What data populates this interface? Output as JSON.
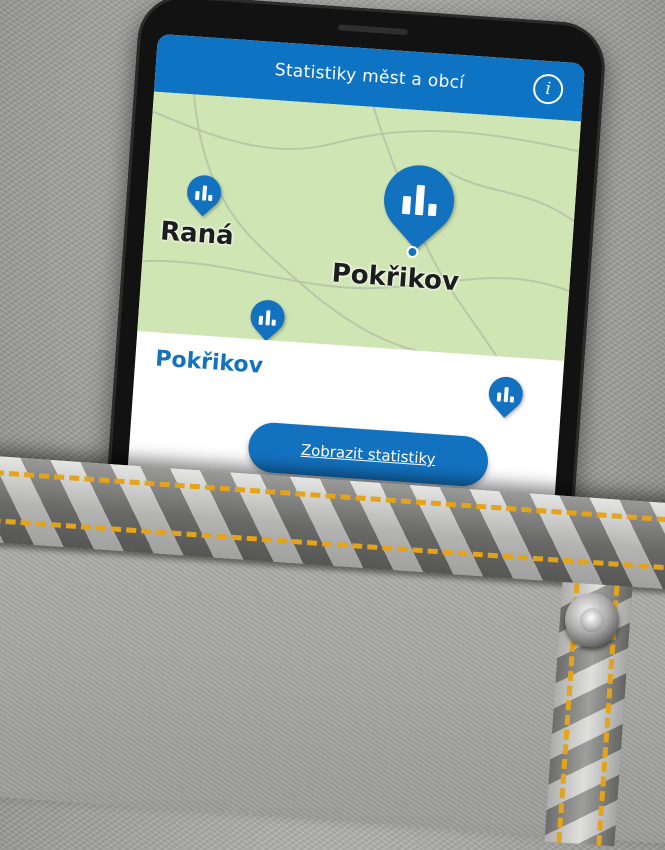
{
  "app": {
    "title": "Statistiky měst a obcí"
  },
  "map": {
    "places": [
      "Raná",
      "Pokřikov"
    ]
  },
  "detail": {
    "selected_name": "Pokřikov",
    "button_label": "Zobrazit statistiky"
  },
  "icons": {
    "info": "info-icon",
    "pin": "statistics-pin-icon"
  },
  "colors": {
    "header": "#0f73c4",
    "map": "#cfe5b4",
    "pin": "#1372c0",
    "stitch": "#e3a31b"
  }
}
